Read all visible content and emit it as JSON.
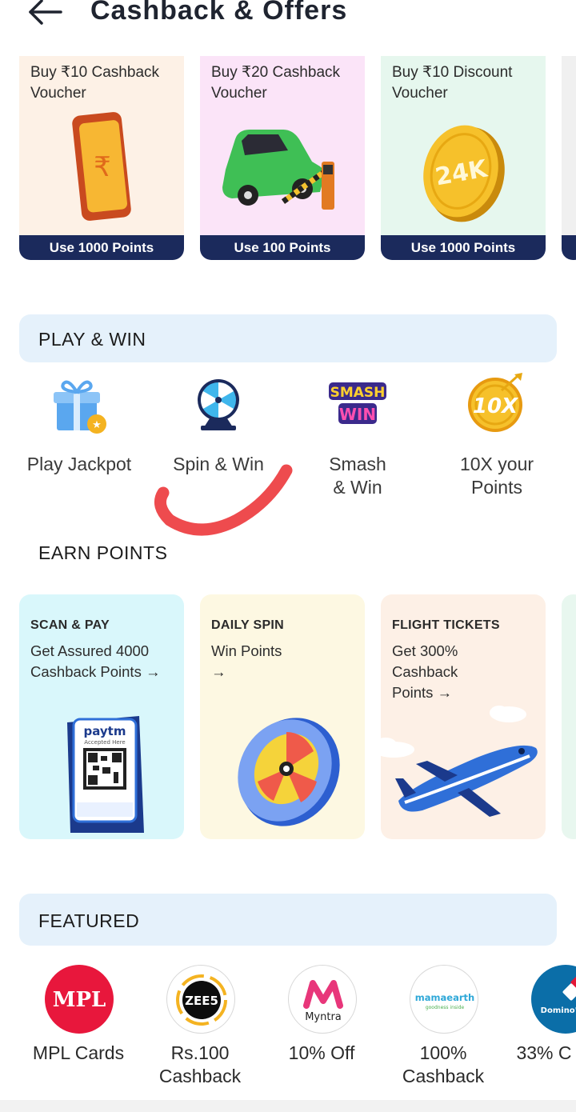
{
  "header": {
    "title": "Cashback & Offers",
    "back_icon": "back-arrow-icon"
  },
  "vouchers": [
    {
      "title": "Buy ₹10 Cashback Voucher",
      "button": "Use 1000 Points",
      "bg": "#fdf1e6",
      "icon": "phone-rupee-icon"
    },
    {
      "title": "Buy ₹20 Cashback Voucher",
      "button": "Use 100 Points",
      "bg": "#fbe4f8",
      "icon": "car-toll-icon"
    },
    {
      "title": "Buy ₹10 Discount Voucher",
      "button": "Use 1000 Points",
      "bg": "#e6f7ee",
      "icon": "gold-coin-icon",
      "coin_text": "24K"
    }
  ],
  "play_win": {
    "title": "PLAY & WIN",
    "items": [
      {
        "label": "Play Jackpot",
        "icon": "gift-icon"
      },
      {
        "label": "Spin & Win",
        "icon": "spin-wheel-icon"
      },
      {
        "label": "Smash & Win",
        "icon": "smash-win-icon",
        "logo_line1": "SMASH",
        "logo_line2": "WIN"
      },
      {
        "label": "10X your Points",
        "icon": "10x-coin-icon",
        "coin_text": "10X"
      }
    ]
  },
  "earn_points": {
    "title": "EARN POINTS",
    "cards": [
      {
        "tag": "SCAN & PAY",
        "desc": "Get Assured 4000 Cashback Points →",
        "bg": "#d9f7fb",
        "icon": "paytm-qr-stand-icon",
        "brand": "paytm",
        "qr_caption": "Accepted Here"
      },
      {
        "tag": "DAILY SPIN",
        "desc": "Win Points →",
        "bg": "#fdf8e2",
        "icon": "spin-wheel-icon"
      },
      {
        "tag": "FLIGHT TICKETS",
        "desc": "Get 300% Cashback Points →",
        "bg": "#fdf0e6",
        "icon": "airplane-icon"
      }
    ]
  },
  "featured": {
    "title": "FEATURED",
    "items": [
      {
        "label": "MPL Cards",
        "icon": "mpl-logo-icon",
        "logo_text": "MPL"
      },
      {
        "label": "Rs.100 Cashback",
        "icon": "zee5-logo-icon",
        "logo_text": "ZEE5"
      },
      {
        "label": "10% Off",
        "icon": "myntra-logo-icon",
        "logo_text": "Myntra"
      },
      {
        "label": "100% Cashback",
        "icon": "mamaearth-logo-icon",
        "logo_text": "mamaearth",
        "logo_sub": "goodness inside"
      },
      {
        "label": "33% C",
        "icon": "dominos-logo-icon",
        "logo_text": "Domino's Pizza"
      }
    ]
  }
}
